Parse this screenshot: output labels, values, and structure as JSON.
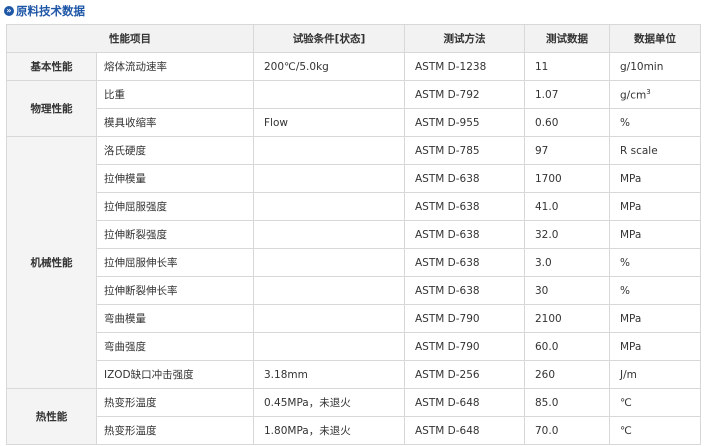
{
  "section_title": "原料技术数据",
  "headers": [
    "性能项目",
    "试验条件[状态]",
    "测试方法",
    "测试数据",
    "数据单位"
  ],
  "groups": {
    "basic": "基本性能",
    "physical": "物理性能",
    "mechanical": "机械性能",
    "thermal": "热性能"
  },
  "rows": [
    {
      "property": "熔体流动速率",
      "condition": "200℃/5.0kg",
      "method": "ASTM D-1238",
      "value": "11",
      "unit": "g/10min"
    },
    {
      "property": "比重",
      "condition": "",
      "method": "ASTM D-792",
      "value": "1.07",
      "unit": "g/cm",
      "unit_sup": "3"
    },
    {
      "property": "模具收缩率",
      "condition": "Flow",
      "method": "ASTM D-955",
      "value": "0.60",
      "unit": "%"
    },
    {
      "property": "洛氏硬度",
      "condition": "",
      "method": "ASTM D-785",
      "value": "97",
      "unit": "R scale"
    },
    {
      "property": "拉伸模量",
      "condition": "",
      "method": "ASTM D-638",
      "value": "1700",
      "unit": "MPa"
    },
    {
      "property": "拉伸屈服强度",
      "condition": "",
      "method": "ASTM D-638",
      "value": "41.0",
      "unit": "MPa"
    },
    {
      "property": "拉伸断裂强度",
      "condition": "",
      "method": "ASTM D-638",
      "value": "32.0",
      "unit": "MPa"
    },
    {
      "property": "拉伸屈服伸长率",
      "condition": "",
      "method": "ASTM D-638",
      "value": "3.0",
      "unit": "%"
    },
    {
      "property": "拉伸断裂伸长率",
      "condition": "",
      "method": "ASTM D-638",
      "value": "30",
      "unit": "%"
    },
    {
      "property": "弯曲模量",
      "condition": "",
      "method": "ASTM D-790",
      "value": "2100",
      "unit": "MPa"
    },
    {
      "property": "弯曲强度",
      "condition": "",
      "method": "ASTM D-790",
      "value": "60.0",
      "unit": "MPa"
    },
    {
      "property": "IZOD缺口冲击强度",
      "condition": "3.18mm",
      "method": "ASTM D-256",
      "value": "260",
      "unit": "J/m"
    },
    {
      "property": "热变形温度",
      "condition": "0.45MPa，未退火",
      "method": "ASTM D-648",
      "value": "85.0",
      "unit": "℃"
    },
    {
      "property": "热变形温度",
      "condition": "1.80MPa，未退火",
      "method": "ASTM D-648",
      "value": "70.0",
      "unit": "℃"
    }
  ]
}
